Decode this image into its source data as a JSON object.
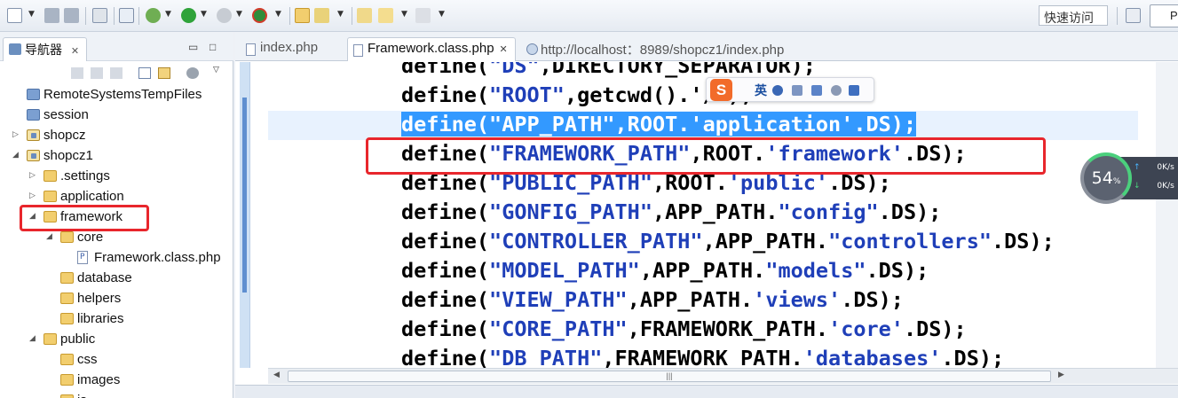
{
  "toolbar": {
    "quick_access": "快速访问",
    "perspective_label": "P"
  },
  "navigator": {
    "tab_label": "导航器",
    "tab_close": "✕",
    "minimize": "▭",
    "maximize": "□",
    "tree": [
      {
        "label": "RemoteSystemsTempFiles",
        "indent": 0,
        "twisty": "",
        "icon": "plain"
      },
      {
        "label": "session",
        "indent": 0,
        "twisty": "",
        "icon": "plain"
      },
      {
        "label": "shopcz",
        "indent": 0,
        "twisty": "▷",
        "icon": "project"
      },
      {
        "label": "shopcz1",
        "indent": 0,
        "twisty": "◢",
        "icon": "project"
      },
      {
        "label": ".settings",
        "indent": 1,
        "twisty": "▷",
        "icon": "folder"
      },
      {
        "label": "application",
        "indent": 1,
        "twisty": "▷",
        "icon": "folder"
      },
      {
        "label": "framework",
        "indent": 1,
        "twisty": "◢",
        "icon": "folder"
      },
      {
        "label": "core",
        "indent": 2,
        "twisty": "◢",
        "icon": "folder"
      },
      {
        "label": "Framework.class.php",
        "indent": 3,
        "twisty": "",
        "icon": "php"
      },
      {
        "label": "database",
        "indent": 2,
        "twisty": "",
        "icon": "folder"
      },
      {
        "label": "helpers",
        "indent": 2,
        "twisty": "",
        "icon": "folder"
      },
      {
        "label": "libraries",
        "indent": 2,
        "twisty": "",
        "icon": "folder"
      },
      {
        "label": "public",
        "indent": 1,
        "twisty": "◢",
        "icon": "folder"
      },
      {
        "label": "css",
        "indent": 2,
        "twisty": "",
        "icon": "folder"
      },
      {
        "label": "images",
        "indent": 2,
        "twisty": "",
        "icon": "folder"
      },
      {
        "label": "js",
        "indent": 2,
        "twisty": "",
        "icon": "folder"
      }
    ]
  },
  "editor": {
    "tabs": [
      {
        "label": "index.php",
        "active": false,
        "icon": "file",
        "close": ""
      },
      {
        "label": "Framework.class.php",
        "active": true,
        "icon": "file",
        "close": "✕"
      },
      {
        "label": "http://localhost：8989/shopcz1/index.php",
        "active": false,
        "icon": "globe",
        "close": ""
      }
    ],
    "lines": [
      [
        [
          "define(",
          ""
        ],
        [
          "\"DS\"",
          "str"
        ],
        [
          ",DIRECTORY_SEPARATOR);",
          ""
        ]
      ],
      [
        [
          "define(",
          ""
        ],
        [
          "\"ROOT\"",
          "str"
        ],
        [
          ",getcwd().'/');",
          ""
        ]
      ],
      [
        [
          "define(",
          ""
        ],
        [
          "\"APP_PATH\"",
          "str"
        ],
        [
          ",ROOT.",
          ""
        ],
        [
          "'application'",
          "str"
        ],
        [
          ".DS);",
          ""
        ]
      ],
      [
        [
          "define(",
          ""
        ],
        [
          "\"FRAMEWORK_PATH\"",
          "str"
        ],
        [
          ",ROOT.",
          ""
        ],
        [
          "'framework'",
          "str"
        ],
        [
          ".DS);",
          ""
        ]
      ],
      [
        [
          "define(",
          ""
        ],
        [
          "\"PUBLIC_PATH\"",
          "str"
        ],
        [
          ",ROOT.",
          ""
        ],
        [
          "'public'",
          "str"
        ],
        [
          ".DS);",
          ""
        ]
      ],
      [
        [
          "define(",
          ""
        ],
        [
          "\"GONFIG_PATH\"",
          "str"
        ],
        [
          ",APP_PATH.",
          ""
        ],
        [
          "\"config\"",
          "str"
        ],
        [
          ".DS);",
          ""
        ]
      ],
      [
        [
          "define(",
          ""
        ],
        [
          "\"CONTROLLER_PATH\"",
          "str"
        ],
        [
          ",APP_PATH.",
          ""
        ],
        [
          "\"controllers\"",
          "str"
        ],
        [
          ".DS);",
          ""
        ]
      ],
      [
        [
          "define(",
          ""
        ],
        [
          "\"MODEL_PATH\"",
          "str"
        ],
        [
          ",APP_PATH.",
          ""
        ],
        [
          "\"models\"",
          "str"
        ],
        [
          ".DS);",
          ""
        ]
      ],
      [
        [
          "define(",
          ""
        ],
        [
          "\"VIEW_PATH\"",
          "str"
        ],
        [
          ",APP_PATH.",
          ""
        ],
        [
          "'views'",
          "str"
        ],
        [
          ".DS);",
          ""
        ]
      ],
      [
        [
          "define(",
          ""
        ],
        [
          "\"CORE_PATH\"",
          "str"
        ],
        [
          ",FRAMEWORK_PATH.",
          ""
        ],
        [
          "'core'",
          "str"
        ],
        [
          ".DS);",
          ""
        ]
      ],
      [
        [
          "define(",
          ""
        ],
        [
          "\"DB_PATH\"",
          "str"
        ],
        [
          ",FRAMEWORK_PATH.",
          ""
        ],
        [
          "'databases'",
          "str"
        ],
        [
          ".DS);",
          ""
        ]
      ]
    ],
    "selected_line": 2,
    "scroll_grip": "|||"
  },
  "ime": {
    "logo": "S",
    "mode": "英"
  },
  "netmon": {
    "percent": "54",
    "percent_unit": "%",
    "upload": "0K/s",
    "download": "0K/s",
    "up_arrow": "↑",
    "down_arrow": "↓"
  },
  "colors": {
    "string": "#1f3fb8",
    "selection": "#3399ff",
    "highlight_box": "#e8262c"
  }
}
